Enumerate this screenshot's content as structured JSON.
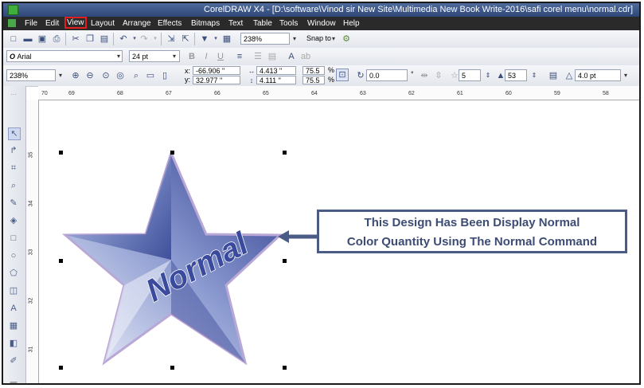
{
  "window": {
    "title": "CorelDRAW X4 - [D:\\software\\Vinod sir New Site\\Multimedia New Book Write-2016\\safi corel menu\\normal.cdr]"
  },
  "menu": {
    "items": [
      "File",
      "Edit",
      "View",
      "Layout",
      "Arrange",
      "Effects",
      "Bitmaps",
      "Text",
      "Table",
      "Tools",
      "Window",
      "Help"
    ],
    "active": "View"
  },
  "standard_toolbar": {
    "zoom_value": "238%",
    "snap_label": "Snap to"
  },
  "text_toolbar": {
    "font": "Arial",
    "font_size": "24 pt"
  },
  "property_bar": {
    "zoom_value": "238%",
    "x_value": "-66.906 \"",
    "y_value": "32.977 \"",
    "width_value": "4.413 \"",
    "height_value": "4.111 \"",
    "scale_x": "75.5",
    "scale_y": "75.5",
    "percent": "%",
    "rotation": "0.0",
    "degree": "°",
    "points": "5",
    "sharpness": "53",
    "outline": "4.0 pt",
    "x_label": "x:",
    "y_label": "y:"
  },
  "rulers": {
    "horizontal": [
      "70",
      "69",
      "68",
      "67",
      "66",
      "65",
      "64",
      "63",
      "62",
      "61",
      "60",
      "59",
      "58"
    ],
    "vertical": [
      "35",
      "34",
      "33",
      "32",
      "31"
    ]
  },
  "canvas": {
    "star_text": "Normal",
    "callout_line1": "This Design  Has Been Display Normal",
    "callout_line2": "Color Quantity Using The Normal Command"
  },
  "colors": {
    "accent": "#4a5b85",
    "active_outline": "#e02020",
    "star_dark": "#2c3a8c",
    "star_light": "#e8ecf7"
  }
}
